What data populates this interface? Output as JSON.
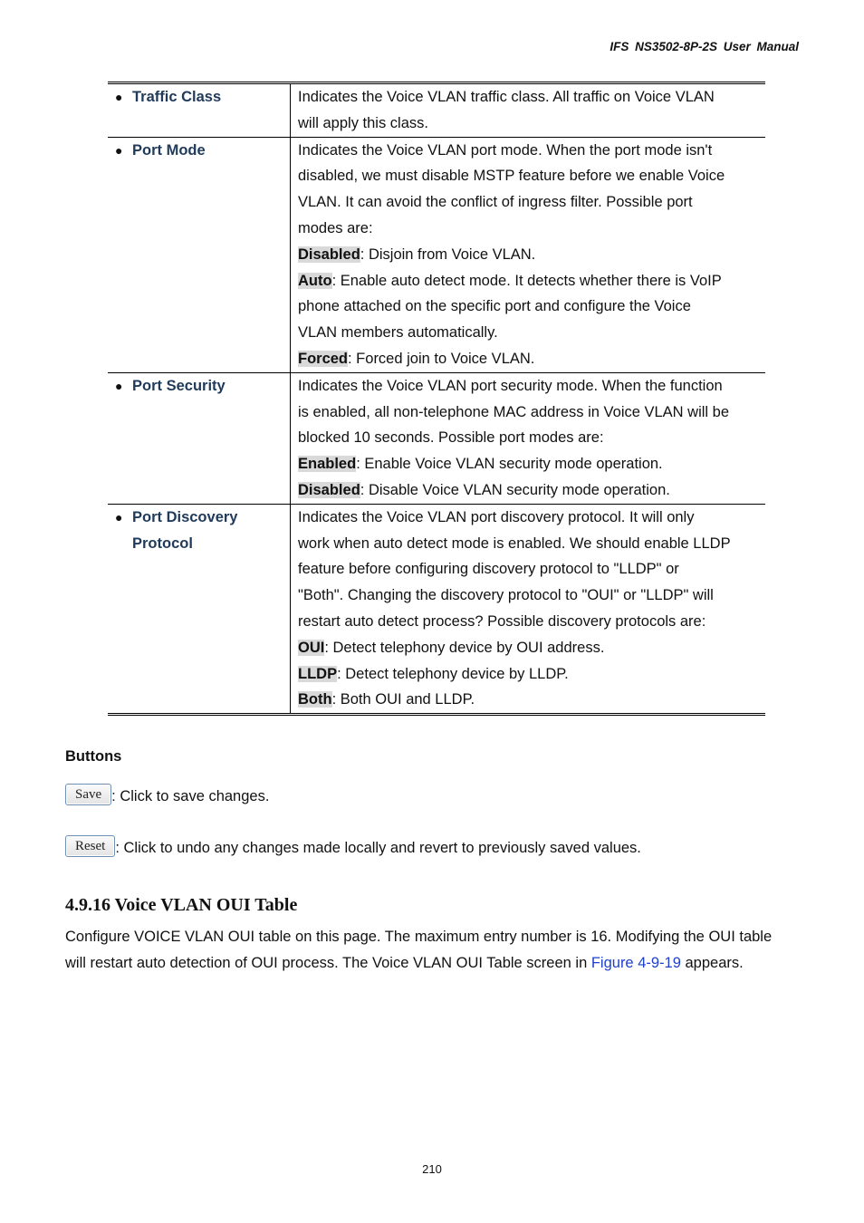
{
  "header": {
    "title": "IFS  NS3502-8P-2S  User  Manual"
  },
  "parameters": [
    {
      "name": "Traffic Class",
      "description_lines": [
        "Indicates the Voice VLAN traffic class. All traffic on Voice VLAN",
        "will apply this class."
      ],
      "options": []
    },
    {
      "name": "Port Mode",
      "description_lines": [
        "Indicates the Voice VLAN port mode. When the port mode isn't",
        "disabled, we must disable MSTP feature before we enable Voice",
        "VLAN. It can avoid the conflict of ingress filter. Possible port",
        "modes are:"
      ],
      "options": [
        {
          "label": "Disabled",
          "text_lines": [
            ": Disjoin from Voice VLAN."
          ]
        },
        {
          "label": "Auto",
          "text_lines": [
            ": Enable auto detect mode. It detects whether there is VoIP",
            "phone attached on the specific port and configure the Voice",
            "VLAN members automatically."
          ]
        },
        {
          "label": "Forced",
          "text_lines": [
            ": Forced join to Voice VLAN."
          ]
        }
      ]
    },
    {
      "name": "Port Security",
      "description_lines": [
        "Indicates the Voice VLAN port security mode. When the function",
        "is enabled, all non-telephone MAC address in Voice VLAN will be",
        "blocked 10 seconds. Possible port modes are:"
      ],
      "options": [
        {
          "label": "Enabled",
          "text_lines": [
            ": Enable Voice VLAN security mode operation."
          ]
        },
        {
          "label": "Disabled",
          "text_lines": [
            ": Disable Voice VLAN security mode operation."
          ]
        }
      ]
    },
    {
      "name_lines": [
        "Port Discovery",
        "Protocol"
      ],
      "description_lines": [
        "Indicates the Voice VLAN port discovery protocol. It will only",
        "work when auto detect mode is enabled. We should enable LLDP",
        "feature before configuring discovery protocol to \"LLDP\" or",
        "\"Both\". Changing the discovery protocol to \"OUI\" or \"LLDP\" will",
        "restart auto detect process? Possible discovery protocols are:"
      ],
      "options": [
        {
          "label": "OUI",
          "text_lines": [
            ": Detect telephony device by OUI address."
          ]
        },
        {
          "label": "LLDP",
          "text_lines": [
            ": Detect telephony device by LLDP."
          ]
        },
        {
          "label": "Both",
          "text_lines": [
            ": Both OUI and LLDP."
          ]
        }
      ]
    }
  ],
  "buttons_section": {
    "label": "Buttons",
    "save": {
      "label": "Save",
      "description": ": Click to save changes."
    },
    "reset": {
      "label": "Reset",
      "description": ": Click to undo any changes made locally and revert to previously saved values."
    }
  },
  "section": {
    "title": "4.9.16 Voice VLAN OUI Table",
    "text_before_link": "Configure VOICE VLAN OUI table on this page. The maximum entry number is 16. Modifying the OUI table will restart auto detection of OUI process. The Voice VLAN OUI Table screen in ",
    "link_text": "Figure 4-9-19",
    "text_after_link": " appears."
  },
  "footer": {
    "page_number": "210"
  },
  "colors": {
    "param_name": "#1f3a5a",
    "link": "#1f3fcf",
    "option_highlight": "#d9d9d9"
  }
}
